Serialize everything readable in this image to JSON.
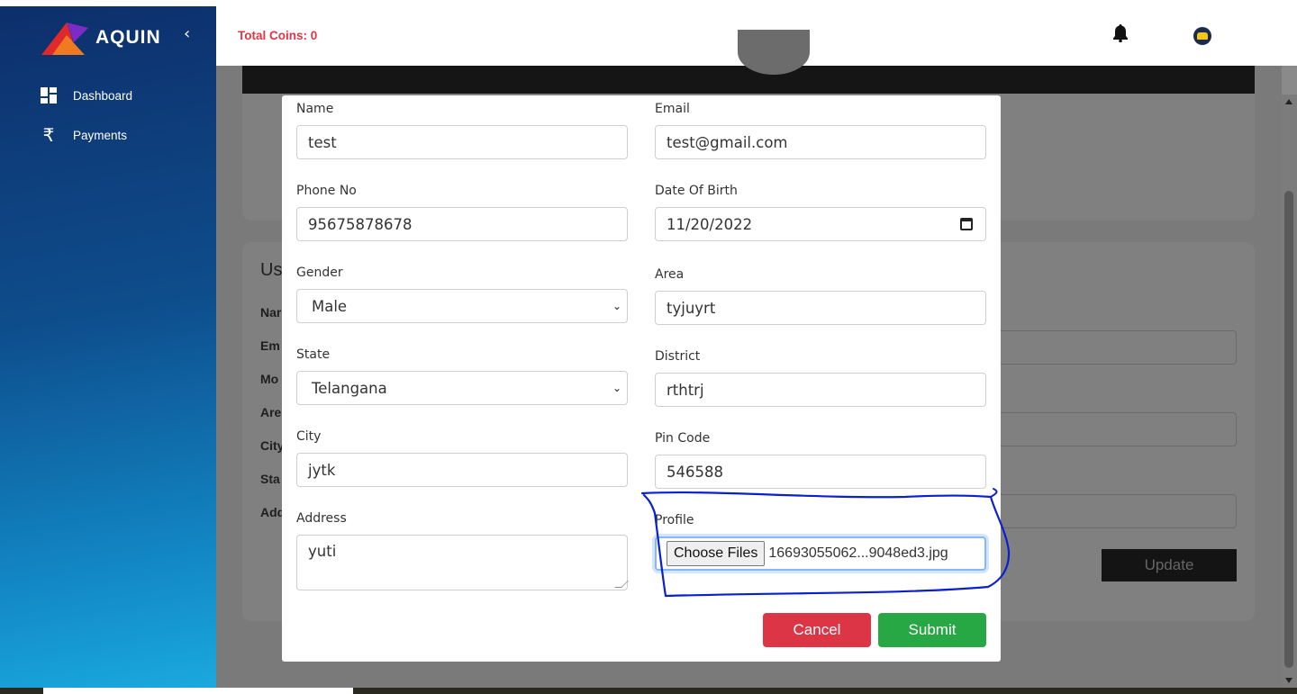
{
  "sidebar": {
    "logo_text": "AQUIN",
    "collapse_icon": "chevron-left-icon",
    "items": [
      {
        "label": "Dashboard",
        "icon": "dashboard-grid-icon"
      },
      {
        "label": "Payments",
        "icon": "rupee-icon"
      }
    ]
  },
  "header": {
    "coins_label": "Total Coins: 0",
    "bell_icon": "bell-icon",
    "avatar_icon": "avatar-icon"
  },
  "background": {
    "section_title": "Us",
    "labels": [
      "Nar",
      "Em",
      "Mo",
      "Are",
      "City",
      "Sta",
      "Add"
    ],
    "update_label": "Update"
  },
  "modal": {
    "fields": {
      "name": {
        "label": "Name",
        "value": "test"
      },
      "email": {
        "label": "Email",
        "value": "test@gmail.com"
      },
      "phone": {
        "label": "Phone No",
        "value": "95675878678"
      },
      "dob": {
        "label": "Date Of Birth",
        "value": "11/20/2022"
      },
      "gender": {
        "label": "Gender",
        "value": "Male"
      },
      "area": {
        "label": "Area",
        "value": "tyjuyrt"
      },
      "state": {
        "label": "State",
        "value": "Telangana"
      },
      "district": {
        "label": "District",
        "value": "rthtrj"
      },
      "city": {
        "label": "City",
        "value": "jytk"
      },
      "pincode": {
        "label": "Pin Code",
        "value": "546588"
      },
      "address": {
        "label": "Address",
        "value": "yuti"
      },
      "profile": {
        "label": "Profile",
        "button": "Choose Files",
        "filename": "16693055062...9048ed3.jpg"
      }
    },
    "cancel_label": "Cancel",
    "submit_label": "Submit"
  },
  "colors": {
    "coins": "#dc3545",
    "cancel": "#dc3545",
    "submit": "#28a745",
    "annotation": "#0a1fd0"
  }
}
